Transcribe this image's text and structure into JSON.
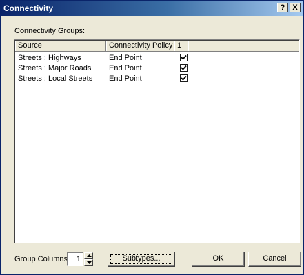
{
  "window": {
    "title": "Connectivity",
    "help_label": "?",
    "close_label": "X"
  },
  "groups_label": "Connectivity Groups:",
  "table": {
    "columns": [
      "Source",
      "Connectivity Policy",
      "1"
    ],
    "rows": [
      {
        "source": "Streets : Highways",
        "policy": "End Point",
        "checked": true
      },
      {
        "source": "Streets : Major Roads",
        "policy": "End Point",
        "checked": true
      },
      {
        "source": "Streets : Local Streets",
        "policy": "End Point",
        "checked": true
      }
    ]
  },
  "group_columns": {
    "label": "Group Columns:",
    "value": "1"
  },
  "buttons": {
    "subtypes": "Subtypes...",
    "ok": "OK",
    "cancel": "Cancel"
  }
}
